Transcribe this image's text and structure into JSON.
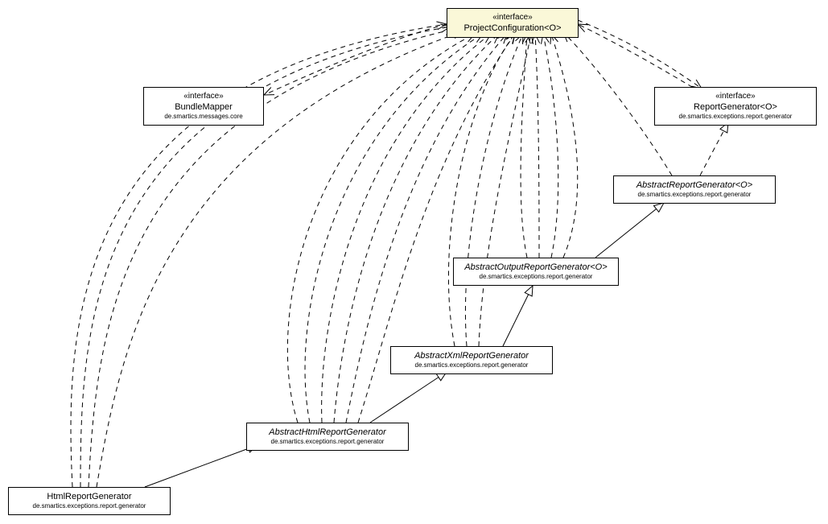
{
  "nodes": {
    "projectConfig": {
      "stereotype": "«interface»",
      "name": "ProjectConfiguration<O>",
      "package": ""
    },
    "bundleMapper": {
      "stereotype": "«interface»",
      "name": "BundleMapper",
      "package": "de.smartics.messages.core"
    },
    "reportGenerator": {
      "stereotype": "«interface»",
      "name": "ReportGenerator<O>",
      "package": "de.smartics.exceptions.report.generator"
    },
    "abstractReportGenerator": {
      "stereotype": "",
      "name": "AbstractReportGenerator<O>",
      "package": "de.smartics.exceptions.report.generator"
    },
    "abstractOutputReportGenerator": {
      "stereotype": "",
      "name": "AbstractOutputReportGenerator<O>",
      "package": "de.smartics.exceptions.report.generator"
    },
    "abstractXmlReportGenerator": {
      "stereotype": "",
      "name": "AbstractXmlReportGenerator",
      "package": "de.smartics.exceptions.report.generator"
    },
    "abstractHtmlReportGenerator": {
      "stereotype": "",
      "name": "AbstractHtmlReportGenerator",
      "package": "de.smartics.exceptions.report.generator"
    },
    "htmlReportGenerator": {
      "stereotype": "",
      "name": "HtmlReportGenerator",
      "package": "de.smartics.exceptions.report.generator"
    }
  }
}
